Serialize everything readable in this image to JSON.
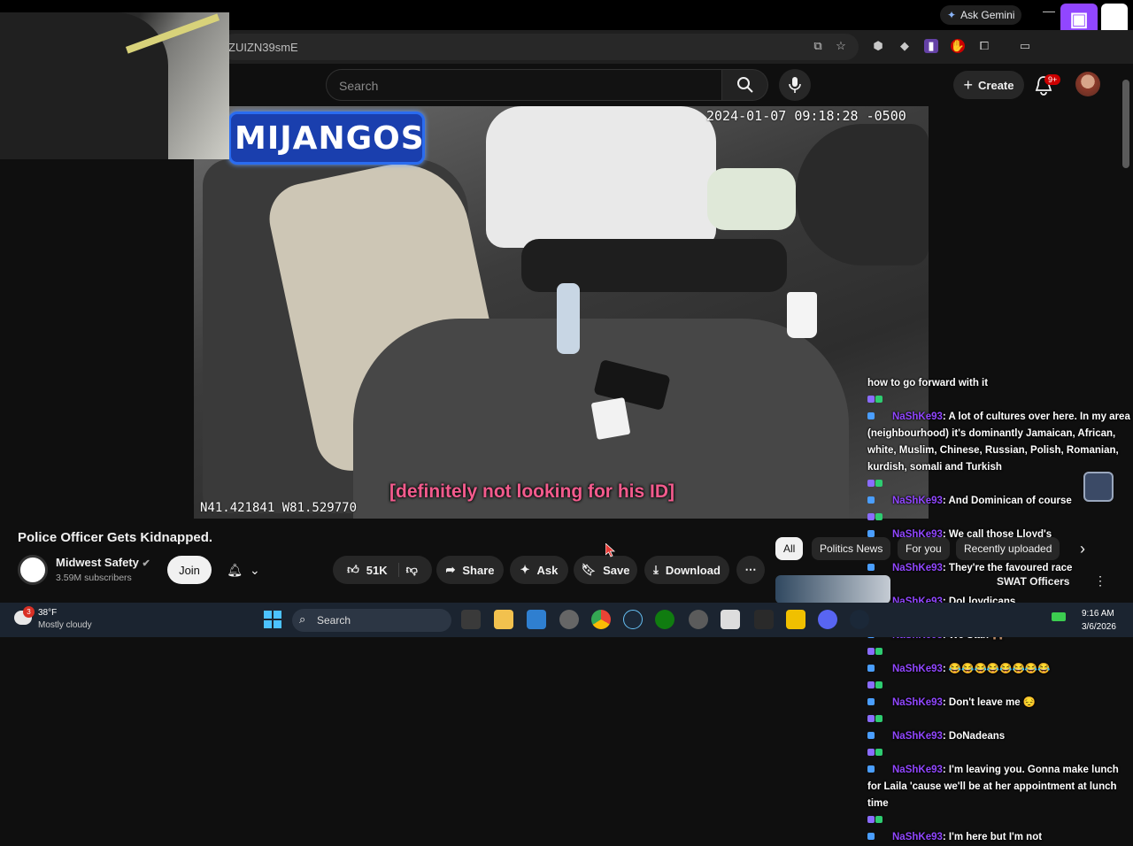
{
  "browser": {
    "url_fragment": "ZUIZN39smE",
    "gemini_label": "Ask Gemini"
  },
  "youtube_header": {
    "search_placeholder": "Search",
    "create_label": "Create",
    "notif_count": "9+"
  },
  "video": {
    "name_banner": "MIJANGOS",
    "timestamp": "2024-01-07 09:18:28 -0500",
    "gps": "N41.421841 W81.529770",
    "caption": "[definitely not looking for his ID]"
  },
  "chat": [
    {
      "user": "",
      "text": "how to go forward with it"
    },
    {
      "user": "NaShKe93",
      "text": ": A lot of cultures over here. In my area (neighbourhood) it's dominantly Jamaican, African, white, Muslim, Chinese, Russian, Polish, Romanian, kurdish, somali and Turkish"
    },
    {
      "user": "NaShKe93",
      "text": ": And Dominican of course"
    },
    {
      "user": "NaShKe93",
      "text": ": We call those Lloyd's"
    },
    {
      "user": "NaShKe93",
      "text": ": They're the favoured race"
    },
    {
      "user": "NaShKe93",
      "text": ": DoLloydicans"
    },
    {
      "user": "NaShKe93",
      "text": ": We Stan 🙌🏽"
    },
    {
      "user": "NaShKe93",
      "text": ": 😂😂😂😂😂😂😂😂"
    },
    {
      "user": "NaShKe93",
      "text": ": Don't leave me 😔"
    },
    {
      "user": "NaShKe93",
      "text": ": DoNadeans"
    },
    {
      "user": "NaShKe93",
      "text": ": I'm leaving you. Gonna make lunch for Laila 'cause we'll be at her appointment at lunch time"
    },
    {
      "user": "NaShKe93",
      "text": ": I'm here but I'm not"
    }
  ],
  "video_info": {
    "title": "Police Officer Gets Kidnapped.",
    "channel": "Midwest Safety",
    "subscribers": "3.59M subscribers",
    "join": "Join",
    "likes": "51K",
    "share": "Share",
    "ask": "Ask",
    "save": "Save",
    "download": "Download"
  },
  "chips": [
    "All",
    "Politics News",
    "For you",
    "Recently uploaded"
  ],
  "suggested": {
    "title": "SWAT Officers"
  },
  "taskbar": {
    "temp": "38°F",
    "weather": "Mostly cloudy",
    "search": "Search",
    "time": "9:16 AM",
    "date": "3/6/2026",
    "weather_badge": "3"
  },
  "colors": {
    "chat_user": "#9147ff",
    "caption": "#f35b8d",
    "banner": "#1a3fae",
    "accent_red": "#cc0000"
  }
}
